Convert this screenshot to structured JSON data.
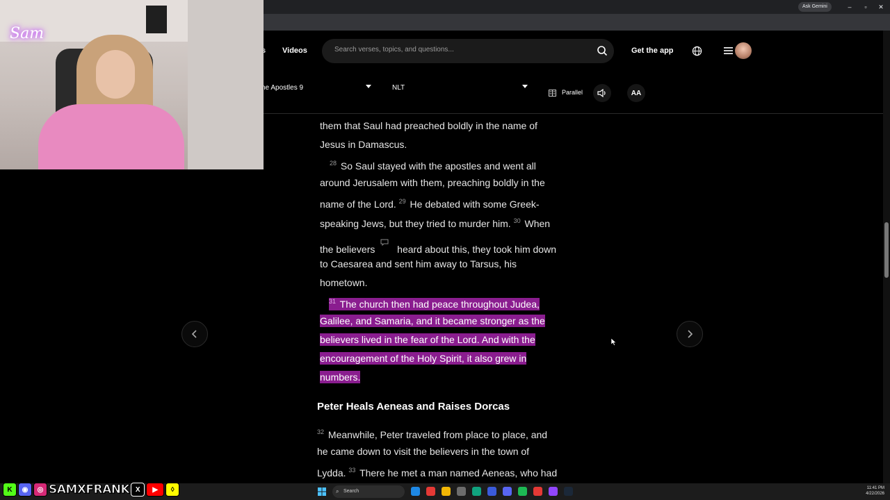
{
  "browser": {
    "gemini_label": "Ask Gemini",
    "window_controls": [
      "–",
      "▫",
      "✕"
    ]
  },
  "header": {
    "nav_partial": "s",
    "videos_label": "Videos",
    "search_placeholder": "Search verses, topics, and questions...",
    "get_app_label": "Get the app"
  },
  "toolbar": {
    "book_select": "ne Apostles 9",
    "version_select": "NLT",
    "parallel_label": "Parallel",
    "font_size_label": "AA"
  },
  "reader": {
    "line1": "them that Saul had preached boldly in the name of",
    "line2": "Jesus in Damascus.",
    "v28_num": "28",
    "line3": "So Saul stayed with the apostles and went all",
    "line4": "around Jerusalem with them, preaching boldly in the",
    "line5a": "name of the Lord.",
    "v29_num": "29",
    "line5b": "He debated with some Greek-",
    "line6a": "speaking Jews, but they tried to murder him.",
    "v30_num": "30",
    "line6b": "When",
    "line7a": "the believers",
    "line7b": "heard about this, they took him down",
    "line8": "to Caesarea and sent him away to Tarsus, his",
    "line9": "hometown.",
    "v31_num": "31",
    "hl1": "The church then had peace throughout Judea,",
    "hl2": "Galilee, and Samaria, and it became stronger as the",
    "hl3": "believers lived in the fear of the Lord. And with the",
    "hl4": "encouragement of the Holy Spirit, it also grew in",
    "hl5": "numbers.",
    "section_title": "Peter Heals Aeneas and Raises Dorcas",
    "v32_num": "32",
    "line10": "Meanwhile, Peter traveled from place to place, and",
    "line11": "he came down to visit the believers in the town of",
    "line12a": "Lydda.",
    "v33_num": "33",
    "line12b": "There he met a man named Aeneas, who had"
  },
  "overlay": {
    "cam_logo": "Sam",
    "social_handle": "SAMXFRANK"
  },
  "taskbar": {
    "search_label": "Search",
    "time": "11:41 PM",
    "date": "4/22/2026"
  },
  "colors": {
    "highlight": "#8a1d8f",
    "background": "#000000"
  },
  "icons": [
    "search-icon",
    "globe-icon",
    "menu-icon",
    "parallel-icon",
    "audio-icon",
    "chevron-left-icon",
    "chevron-right-icon",
    "note-icon"
  ]
}
